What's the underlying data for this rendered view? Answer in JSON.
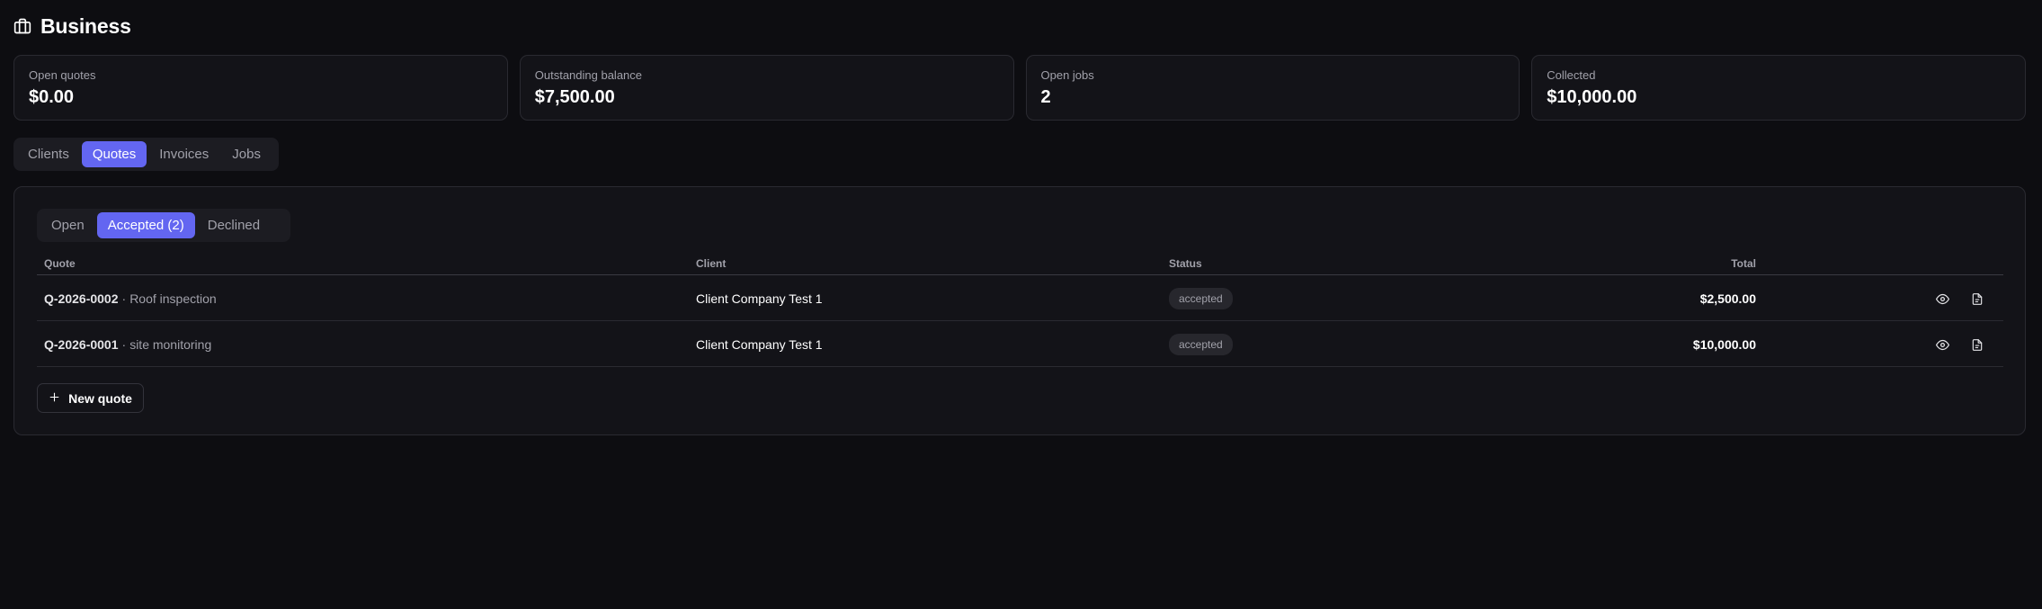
{
  "page": {
    "title": "Business",
    "icon": "briefcase-icon"
  },
  "stats": [
    {
      "label": "Open quotes",
      "value": "$0.00"
    },
    {
      "label": "Outstanding balance",
      "value": "$7,500.00"
    },
    {
      "label": "Open jobs",
      "value": "2"
    },
    {
      "label": "Collected",
      "value": "$10,000.00"
    }
  ],
  "main_tabs": [
    {
      "label": "Clients",
      "active": false
    },
    {
      "label": "Quotes",
      "active": true
    },
    {
      "label": "Invoices",
      "active": false
    },
    {
      "label": "Jobs",
      "active": false
    }
  ],
  "quote_filters": [
    {
      "label": "Open",
      "active": false
    },
    {
      "label": "Accepted (2)",
      "active": true
    },
    {
      "label": "Declined",
      "active": false
    }
  ],
  "table": {
    "columns": [
      "Quote",
      "Client",
      "Status",
      "Total"
    ],
    "rows": [
      {
        "id": "Q-2026-0002",
        "separator": "·",
        "description": "Roof inspection",
        "client": "Client Company Test 1",
        "status": "accepted",
        "total": "$2,500.00",
        "actions": [
          "eye-icon",
          "file-icon"
        ]
      },
      {
        "id": "Q-2026-0001",
        "separator": "·",
        "description": "site monitoring",
        "client": "Client Company Test 1",
        "status": "accepted",
        "total": "$10,000.00",
        "actions": [
          "eye-icon",
          "file-icon"
        ]
      }
    ]
  },
  "new_quote_button": {
    "label": "New quote",
    "icon": "plus-icon"
  },
  "colors": {
    "accent": "#6366f1",
    "background": "#0d0d11",
    "card": "#131318",
    "border": "#2a2a31"
  }
}
